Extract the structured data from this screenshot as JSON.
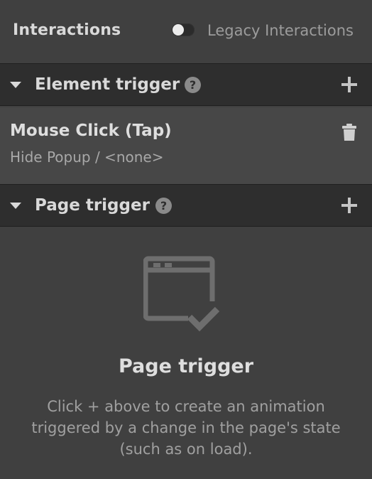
{
  "header": {
    "title": "Interactions",
    "legacy_toggle": {
      "label": "Legacy Interactions",
      "on": false
    }
  },
  "element_trigger": {
    "title": "Element trigger",
    "help_icon": "question-circle-icon",
    "add_icon": "plus-icon",
    "items": [
      {
        "title": "Mouse Click (Tap)",
        "subtitle": "Hide Popup / <none>",
        "delete_icon": "trash-icon"
      }
    ]
  },
  "page_trigger": {
    "title": "Page trigger",
    "help_icon": "question-circle-icon",
    "add_icon": "plus-icon",
    "empty_state": {
      "icon": "browser-window-check-icon",
      "title": "Page trigger",
      "description": "Click + above to create an animation triggered by a change in the page's state (such as on load)."
    }
  },
  "colors": {
    "panel_bg": "#404040",
    "section_bg": "#2e2e2e",
    "item_bg": "#474747",
    "text_primary": "#d9d9d9",
    "text_secondary": "#a0a0a0"
  }
}
